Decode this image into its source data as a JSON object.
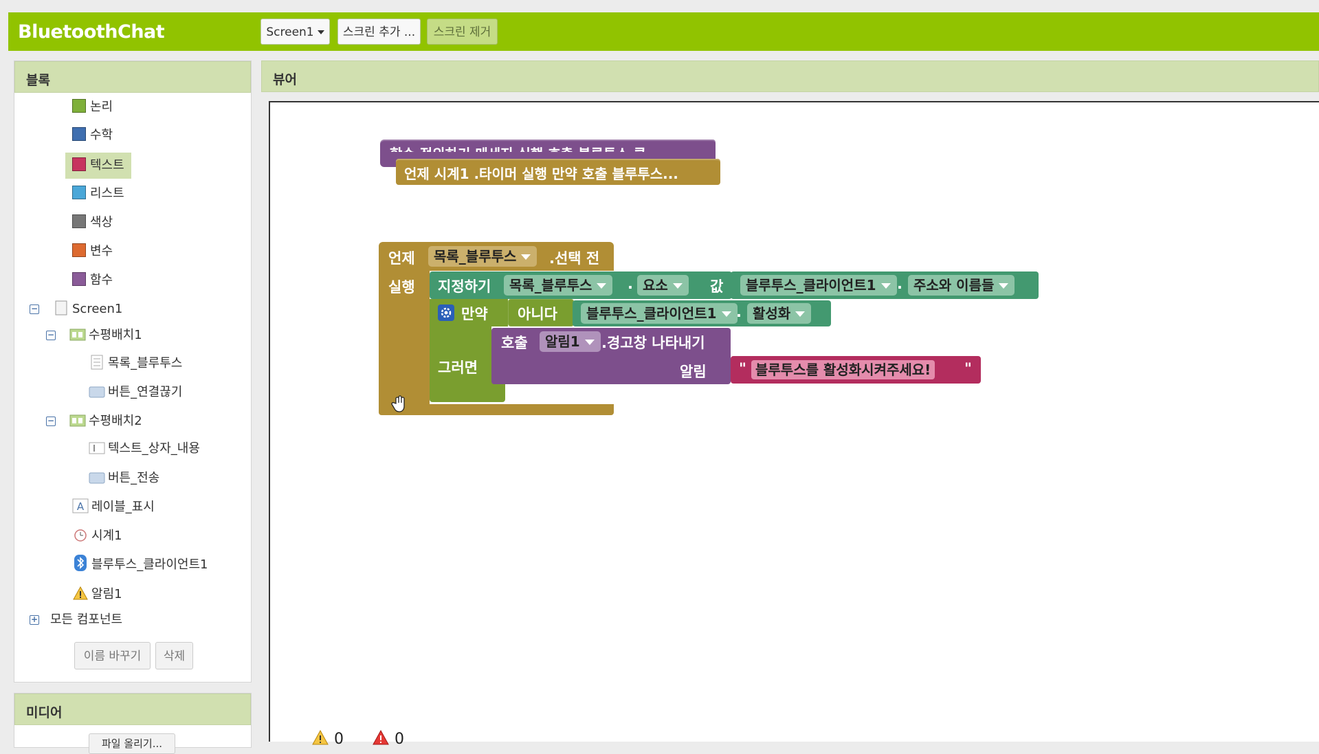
{
  "app": {
    "title": "BluetoothChat",
    "screen_select": "Screen1",
    "add_screen": "스크린 추가 ...",
    "remove_screen": "스크린 제거"
  },
  "blocks_panel": {
    "header": "블록",
    "builtin": [
      {
        "label": "논리",
        "color": "#7fb03a"
      },
      {
        "label": "수학",
        "color": "#3f6fb0"
      },
      {
        "label": "텍스트",
        "color": "#c7345f"
      },
      {
        "label": "리스트",
        "color": "#4aa7d8"
      },
      {
        "label": "색상",
        "color": "#777777"
      },
      {
        "label": "변수",
        "color": "#dd6a30"
      },
      {
        "label": "함수",
        "color": "#8a5b98"
      }
    ],
    "screen": "Screen1",
    "components": {
      "h1": "수평배치1",
      "list_bt": "목록_블루투스",
      "btn_disconnect": "버튼_연결끊기",
      "h2": "수평배치2",
      "textbox": "텍스트_상자_내용",
      "btn_send": "버튼_전송",
      "label_display": "레이블_표시",
      "clock": "시계1",
      "bt_client": "블루투스_클라이언트1",
      "notifier": "알림1"
    },
    "all_components": "모든 컴포넌트",
    "rename": "이름 바꾸기",
    "delete": "삭제"
  },
  "media_panel": {
    "header": "미디어",
    "upload": "파일 올리기..."
  },
  "viewer": {
    "header": "뷰어",
    "collapsed_back": "함수 정의하기 메세지 실행 호출 블루투스 클",
    "collapsed_front": "언제 시계1 .타이머 실행 만약 호출 블루투스...",
    "event": {
      "when": "언제",
      "component": "목록_블루투스",
      "event_name": ".선택 전",
      "do": "실행"
    },
    "set": {
      "keyword": "지정하기",
      "component": "목록_블루투스",
      "dot": ".",
      "property": "요소",
      "value": "값",
      "source_component": "블루투스_클라이언트1",
      "source_dot": ".",
      "source_property": "주소와 이름들"
    },
    "if_block": {
      "if": "만약",
      "not": "아니다",
      "component": "블루투스_클라이언트1",
      "dot": ".",
      "property": "활성화",
      "then": "그러면"
    },
    "call": {
      "keyword": "호출",
      "component": "알림1",
      "method": ".경고창 나타내기",
      "arg_label": "알림",
      "text": "블루투스를 활성화시켜주세요!",
      "quote": "\""
    },
    "warnings": "0",
    "errors": "0"
  },
  "colors": {
    "topbar": "#91c300",
    "event_block": "#b18e35",
    "component_block": "#439970",
    "control_block": "#7a9e2f",
    "procedure_block": "#7d4f8c",
    "text_block": "#b32d5e"
  }
}
